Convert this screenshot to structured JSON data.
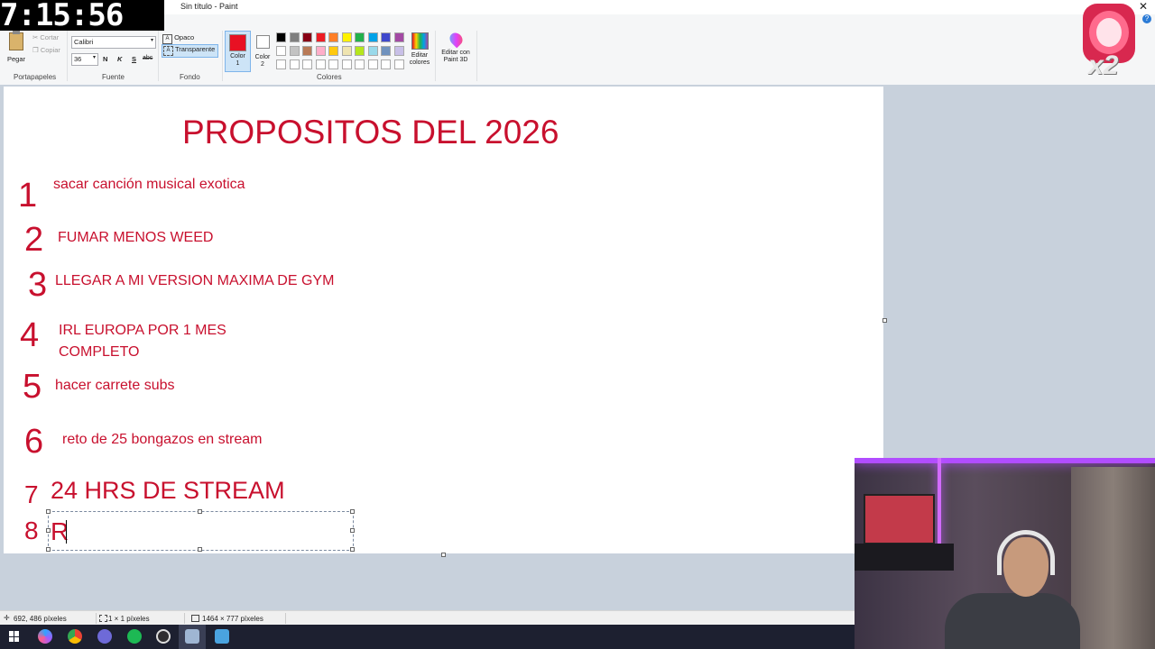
{
  "window": {
    "title": "Sin título - Paint"
  },
  "clock": "7:15:56",
  "ribbon": {
    "clipboard": {
      "paste_label": "Pegar",
      "cut_label": "Cortar",
      "copy_label": "Copiar",
      "group_label": "Portapapeles"
    },
    "font": {
      "family": "Calibri",
      "size": "36",
      "bold": "N",
      "italic": "K",
      "underline": "S",
      "strike": "abc",
      "group_label": "Fuente"
    },
    "background": {
      "opaque_label": "Opaco",
      "transparent_label": "Transparente",
      "group_label": "Fondo"
    },
    "colors": {
      "color1_label": "Color 1",
      "color2_label": "Color 2",
      "color1": "#e81123",
      "color2": "#ffffff",
      "edit_colors_label": "Editar colores",
      "group_label": "Colores",
      "palette_row1": [
        "#000000",
        "#7f7f7f",
        "#880015",
        "#ed1c24",
        "#ff7f27",
        "#fff200",
        "#22b14c",
        "#00a2e8",
        "#3f48cc",
        "#a349a4"
      ],
      "palette_row2": [
        "#ffffff",
        "#c3c3c3",
        "#b97a57",
        "#ffaec9",
        "#ffc90e",
        "#efe4b0",
        "#b5e61d",
        "#99d9ea",
        "#7092be",
        "#c8bfe7"
      ]
    },
    "paint3d": {
      "label": "Editar con Paint 3D"
    }
  },
  "canvas": {
    "heading": "PROPOSITOS DEL 2026",
    "items": [
      {
        "number": "1",
        "text": "sacar canción musical exotica"
      },
      {
        "number": "2",
        "text": "FUMAR MENOS WEED"
      },
      {
        "number": "3",
        "text": "LLEGAR A MI VERSION MAXIMA DE GYM"
      },
      {
        "number": "4",
        "text": "IRL EUROPA POR 1 MES",
        "text2": "COMPLETO"
      },
      {
        "number": "5",
        "text": "hacer carrete subs"
      },
      {
        "number": "6",
        "text": "reto de 25 bongazos en stream"
      },
      {
        "number": "7",
        "text": "24 HRS DE STREAM"
      },
      {
        "number": "8",
        "text": "R"
      }
    ]
  },
  "statusbar": {
    "cursor": "692, 486 píxeles",
    "selection": "1 × 1 píxeles",
    "size": "1464 × 777 píxeles"
  },
  "sticker_text": "x2"
}
